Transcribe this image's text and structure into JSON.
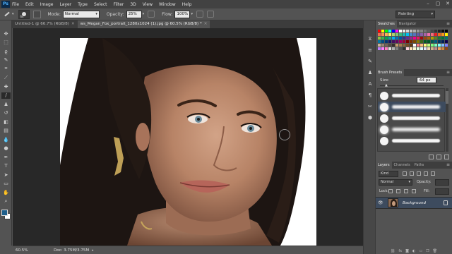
{
  "app": {
    "logo": "Ps",
    "menu": [
      "File",
      "Edit",
      "Image",
      "Layer",
      "Type",
      "Select",
      "Filter",
      "3D",
      "View",
      "Window",
      "Help"
    ],
    "window_controls": [
      "–",
      "▢",
      "✕"
    ]
  },
  "options_bar": {
    "brush_size": "64",
    "mode_label": "Mode:",
    "mode_value": "Normal",
    "opacity_label": "Opacity:",
    "opacity_value": "25%",
    "flow_label": "Flow:",
    "flow_value": "100%",
    "workspace": "Painting"
  },
  "document_tabs": [
    {
      "label": "Untitled-1 @ 66.7% (RGB/8)",
      "active": false
    },
    {
      "label": "ws_Megan_Fox_portrait_1280x1024 (1).jpg @ 60.5% (RGB/8) *",
      "active": true
    }
  ],
  "status_bar": {
    "zoom": "60.5%",
    "doc": "Doc: 3.75M/3.75M"
  },
  "tools": [
    {
      "name": "move-tool",
      "glyph": "✥"
    },
    {
      "name": "marquee-tool",
      "glyph": "⬚"
    },
    {
      "name": "lasso-tool",
      "glyph": "ϱ"
    },
    {
      "name": "quick-select-tool",
      "glyph": "✎"
    },
    {
      "name": "crop-tool",
      "glyph": "⌗"
    },
    {
      "name": "eyedropper-tool",
      "glyph": "⟋"
    },
    {
      "name": "healing-brush-tool",
      "glyph": "✚"
    },
    {
      "name": "brush-tool",
      "glyph": "∕"
    },
    {
      "name": "clone-stamp-tool",
      "glyph": "♟"
    },
    {
      "name": "history-brush-tool",
      "glyph": "↺"
    },
    {
      "name": "eraser-tool",
      "glyph": "◧"
    },
    {
      "name": "gradient-tool",
      "glyph": "▤"
    },
    {
      "name": "blur-tool",
      "glyph": "💧"
    },
    {
      "name": "dodge-tool",
      "glyph": "●"
    },
    {
      "name": "pen-tool",
      "glyph": "✒"
    },
    {
      "name": "type-tool",
      "glyph": "T"
    },
    {
      "name": "path-select-tool",
      "glyph": "➤"
    },
    {
      "name": "shape-tool",
      "glyph": "▭"
    },
    {
      "name": "hand-tool",
      "glyph": "✋"
    },
    {
      "name": "zoom-tool",
      "glyph": "⌕"
    }
  ],
  "mini_strip_icons": [
    {
      "name": "history-icon",
      "glyph": "⧖"
    },
    {
      "name": "properties-icon",
      "glyph": "≡"
    },
    {
      "name": "brush-panel-icon",
      "glyph": "✎"
    },
    {
      "name": "clone-source-icon",
      "glyph": "♟"
    },
    {
      "name": "character-icon",
      "glyph": "A"
    },
    {
      "name": "paragraph-icon",
      "glyph": "¶"
    },
    {
      "name": "tool-presets-icon",
      "glyph": "✂"
    },
    {
      "name": "3d-icon",
      "glyph": "⬢"
    }
  ],
  "panels": {
    "swatches_tabs": [
      "Swatches",
      "Navigator"
    ],
    "brush_presets_title": "Brush Presets",
    "brush_size_label": "Size:",
    "brush_size_value": "64 px",
    "layers_tabs": [
      "Layers",
      "Channels",
      "Paths"
    ],
    "layers_kind": "Kind",
    "layers_mode": "Normal",
    "layers_opacity_label": "Opacity:",
    "layers_lock_label": "Lock:",
    "layers_fill_label": "Fill:",
    "layer_name": "Background"
  },
  "colors": {
    "foreground": "#1f5f8b",
    "background": "#ffffff",
    "swatches": [
      "#ff0000",
      "#ffff00",
      "#00ff00",
      "#00ffff",
      "#0000ff",
      "#ff00ff",
      "#ffffff",
      "#ebebeb",
      "#d6d6d6",
      "#c2c2c2",
      "#adadad",
      "#999999",
      "#858585",
      "#707070",
      "#5c5c5c",
      "#474747",
      "#333333",
      "#1f1f1f",
      "#0a0a0a",
      "#000000",
      "#f26c4f",
      "#f68e55",
      "#fbaf5c",
      "#fff467",
      "#acd372",
      "#7cc576",
      "#3bb878",
      "#1abbb4",
      "#00bff3",
      "#438ccb",
      "#5574b9",
      "#605ca8",
      "#855fa8",
      "#a763a8",
      "#f06ea9",
      "#f26d7d",
      "#ed1c24",
      "#f26522",
      "#f7941d",
      "#fff200",
      "#8dc63f",
      "#39b54a",
      "#00a651",
      "#00a99d",
      "#00aeef",
      "#0072bc",
      "#0054a6",
      "#2e3192",
      "#662d91",
      "#92278f",
      "#ec008c",
      "#ed145b",
      "#9e0b0f",
      "#a0410d",
      "#a36209",
      "#aba000",
      "#598527",
      "#197b30",
      "#007236",
      "#00746b",
      "#0076a3",
      "#004b80",
      "#003471",
      "#1b1464",
      "#440e62",
      "#630460",
      "#9e005d",
      "#9e0039",
      "#790000",
      "#7b2e00",
      "#7d4900",
      "#827b00",
      "#406618",
      "#005e20",
      "#005826",
      "#005952",
      "#005b7f",
      "#003663",
      "#002157",
      "#0d004c",
      "#c7b299",
      "#998675",
      "#736357",
      "#534741",
      "#37302d",
      "#c69c6d",
      "#a67c52",
      "#8c6239",
      "#754c24",
      "#603913",
      "#ffffff",
      "#ff7f7f",
      "#ffbf7f",
      "#ffff7f",
      "#bfff7f",
      "#7fff7f",
      "#7fffbf",
      "#7fffff",
      "#7fbfff",
      "#7f7fff",
      "#bf7fff",
      "#ff7fff",
      "#ff7fbf",
      "#e0e0e0",
      "#b0b0b0",
      "#808080",
      "#505050",
      "#303030",
      "#ffd1dc",
      "#ffe4b5",
      "#fafad2",
      "#e0ffe0",
      "#e0ffff",
      "#e6e6fa",
      "#f5deb3",
      "#d2b48c",
      "#bc8f8f",
      "#f4a460",
      "#cd853f",
      "#8b4513"
    ]
  }
}
